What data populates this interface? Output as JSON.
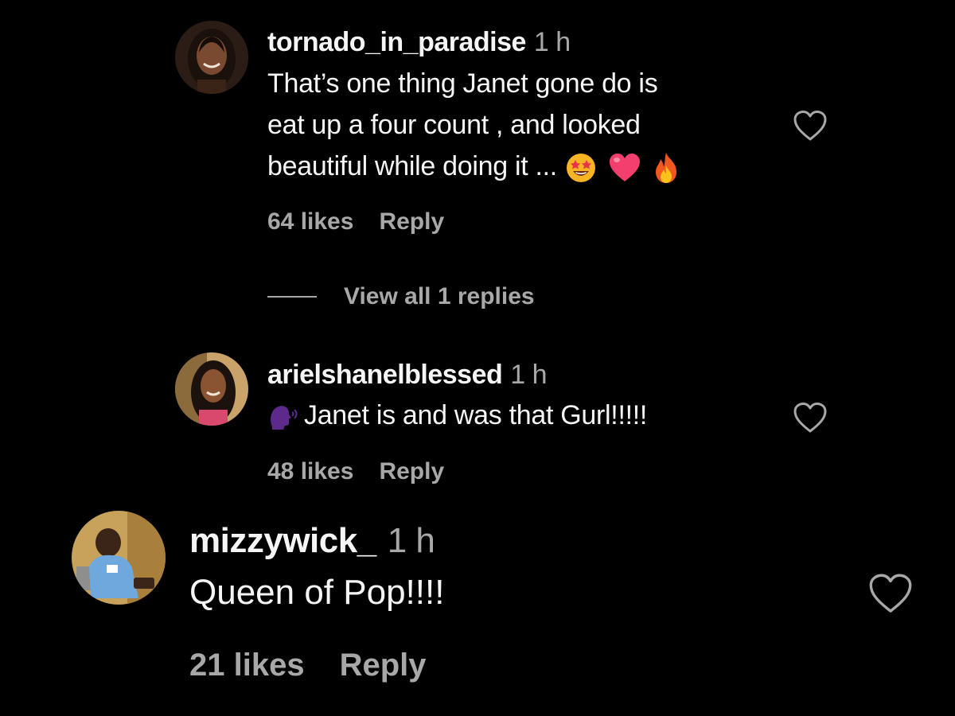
{
  "comments": [
    {
      "username": "tornado_in_paradise",
      "time": "1 h",
      "text_lines": [
        "That’s one thing Janet gone do is",
        "eat up a four count , and looked",
        "beautiful while doing it ..."
      ],
      "emojis": [
        "star-struck-emoji",
        "pink-heart-emoji",
        "fire-emoji"
      ],
      "likes": "64 likes",
      "reply_label": "Reply",
      "liked": false
    },
    {
      "username": "arielshanelblessed",
      "time": "1 h",
      "text_prefix_emoji": "speaking-head-emoji",
      "text": "Janet is and was that Gurl!!!!!",
      "likes": "48 likes",
      "reply_label": "Reply",
      "liked": false
    },
    {
      "username": "mizzywick_",
      "time": "1 h",
      "text": "Queen of Pop!!!!",
      "likes": "21 likes",
      "reply_label": "Reply",
      "liked": false
    }
  ],
  "view_replies": {
    "label": "View all 1 replies"
  },
  "colors": {
    "background": "#000000",
    "primary_text": "#f5f5f5",
    "secondary_text": "#a8a8a8"
  }
}
